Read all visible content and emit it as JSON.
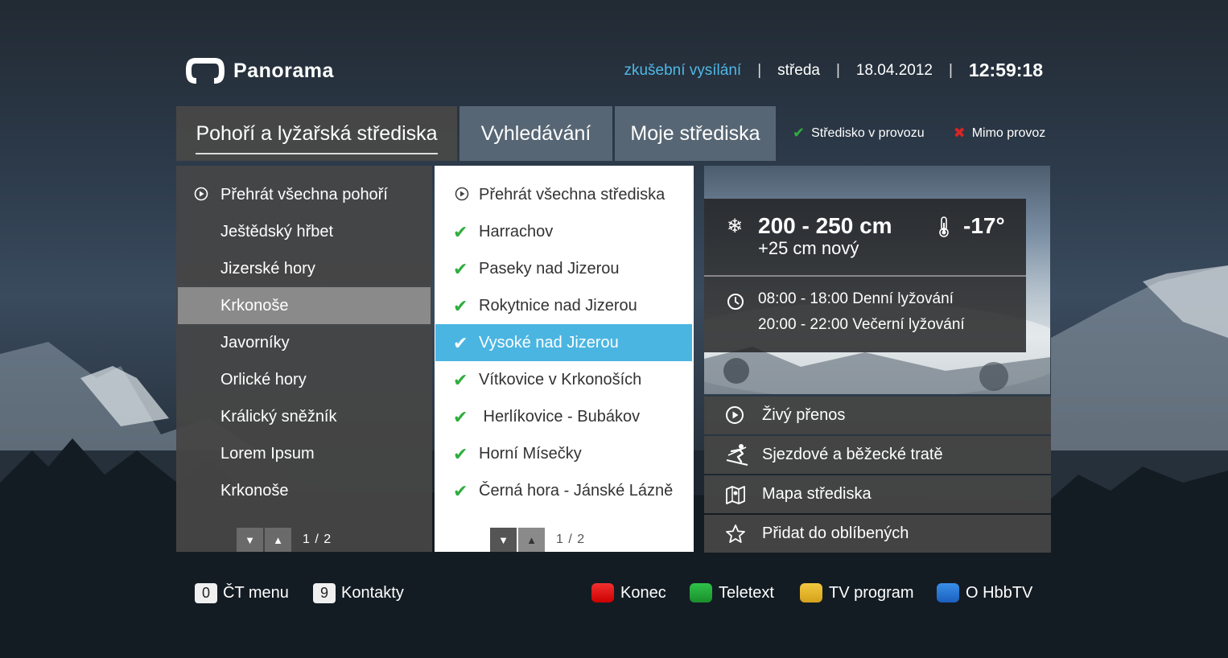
{
  "header": {
    "logo_text": "Panorama",
    "broadcast": "zkušební vysílání",
    "day": "středa",
    "date": "18.04.2012",
    "time": "12:59:18",
    "separator": "|"
  },
  "tabs": [
    {
      "label": "Pohoří a lyžařská střediska",
      "active": true
    },
    {
      "label": "Vyhledávání",
      "active": false
    },
    {
      "label": "Moje střediska",
      "active": false
    }
  ],
  "legend": {
    "open_label": "Středisko v provozu",
    "closed_label": "Mimo provoz",
    "open_icon": "check-icon",
    "closed_icon": "cross-icon"
  },
  "mountains": {
    "items": [
      {
        "label": "Přehrát všechna pohoří",
        "icon": "play-icon"
      },
      {
        "label": "Ještědský hřbet"
      },
      {
        "label": "Jizerské hory"
      },
      {
        "label": "Krkonoše",
        "selected": true
      },
      {
        "label": "Javorníky"
      },
      {
        "label": "Orlické hory"
      },
      {
        "label": "Králický sněžník"
      },
      {
        "label": "Lorem Ipsum"
      },
      {
        "label": "Krkonoše"
      }
    ],
    "pager": "1 / 2"
  },
  "resorts": {
    "items": [
      {
        "label": "Přehrát všechna střediska",
        "icon": "play-icon"
      },
      {
        "label": "Harrachov",
        "status": "open"
      },
      {
        "label": "Paseky nad Jizerou",
        "status": "open"
      },
      {
        "label": "Rokytnice nad Jizerou",
        "status": "open"
      },
      {
        "label": "Vysoké nad Jizerou",
        "status": "open",
        "selected": true
      },
      {
        "label": "Vítkovice v Krkonoších",
        "status": "open"
      },
      {
        "label": " Herlíkovice - Bubákov",
        "status": "open"
      },
      {
        "label": "Horní Mísečky",
        "status": "open"
      },
      {
        "label": "Černá hora - Jánské Lázně",
        "status": "open"
      }
    ],
    "pager": "1 / 2"
  },
  "weather": {
    "snow_depth": "200 - 250 cm",
    "new_snow": "+25 cm nový",
    "temperature": "-17°",
    "hours_day": "08:00 - 18:00 Denní lyžování",
    "hours_night": "20:00 - 22:00 Večerní lyžování"
  },
  "actions": [
    {
      "label": "Živý přenos",
      "icon": "play-circle-icon"
    },
    {
      "label": "Sjezdové a běžecké tratě",
      "icon": "skier-icon"
    },
    {
      "label": "Mapa střediska",
      "icon": "map-icon"
    },
    {
      "label": "Přidat do oblíbených",
      "icon": "star-icon"
    }
  ],
  "footer": {
    "menu_key": "0",
    "menu_label": "ČT menu",
    "contacts_key": "9",
    "contacts_label": "Kontakty",
    "red_label": "Konec",
    "green_label": "Teletext",
    "yellow_label": "TV program",
    "blue_label": "O HbbTV"
  },
  "colors": {
    "accent": "#4bb5e1",
    "open": "#2fae3e",
    "closed": "#d82525"
  }
}
